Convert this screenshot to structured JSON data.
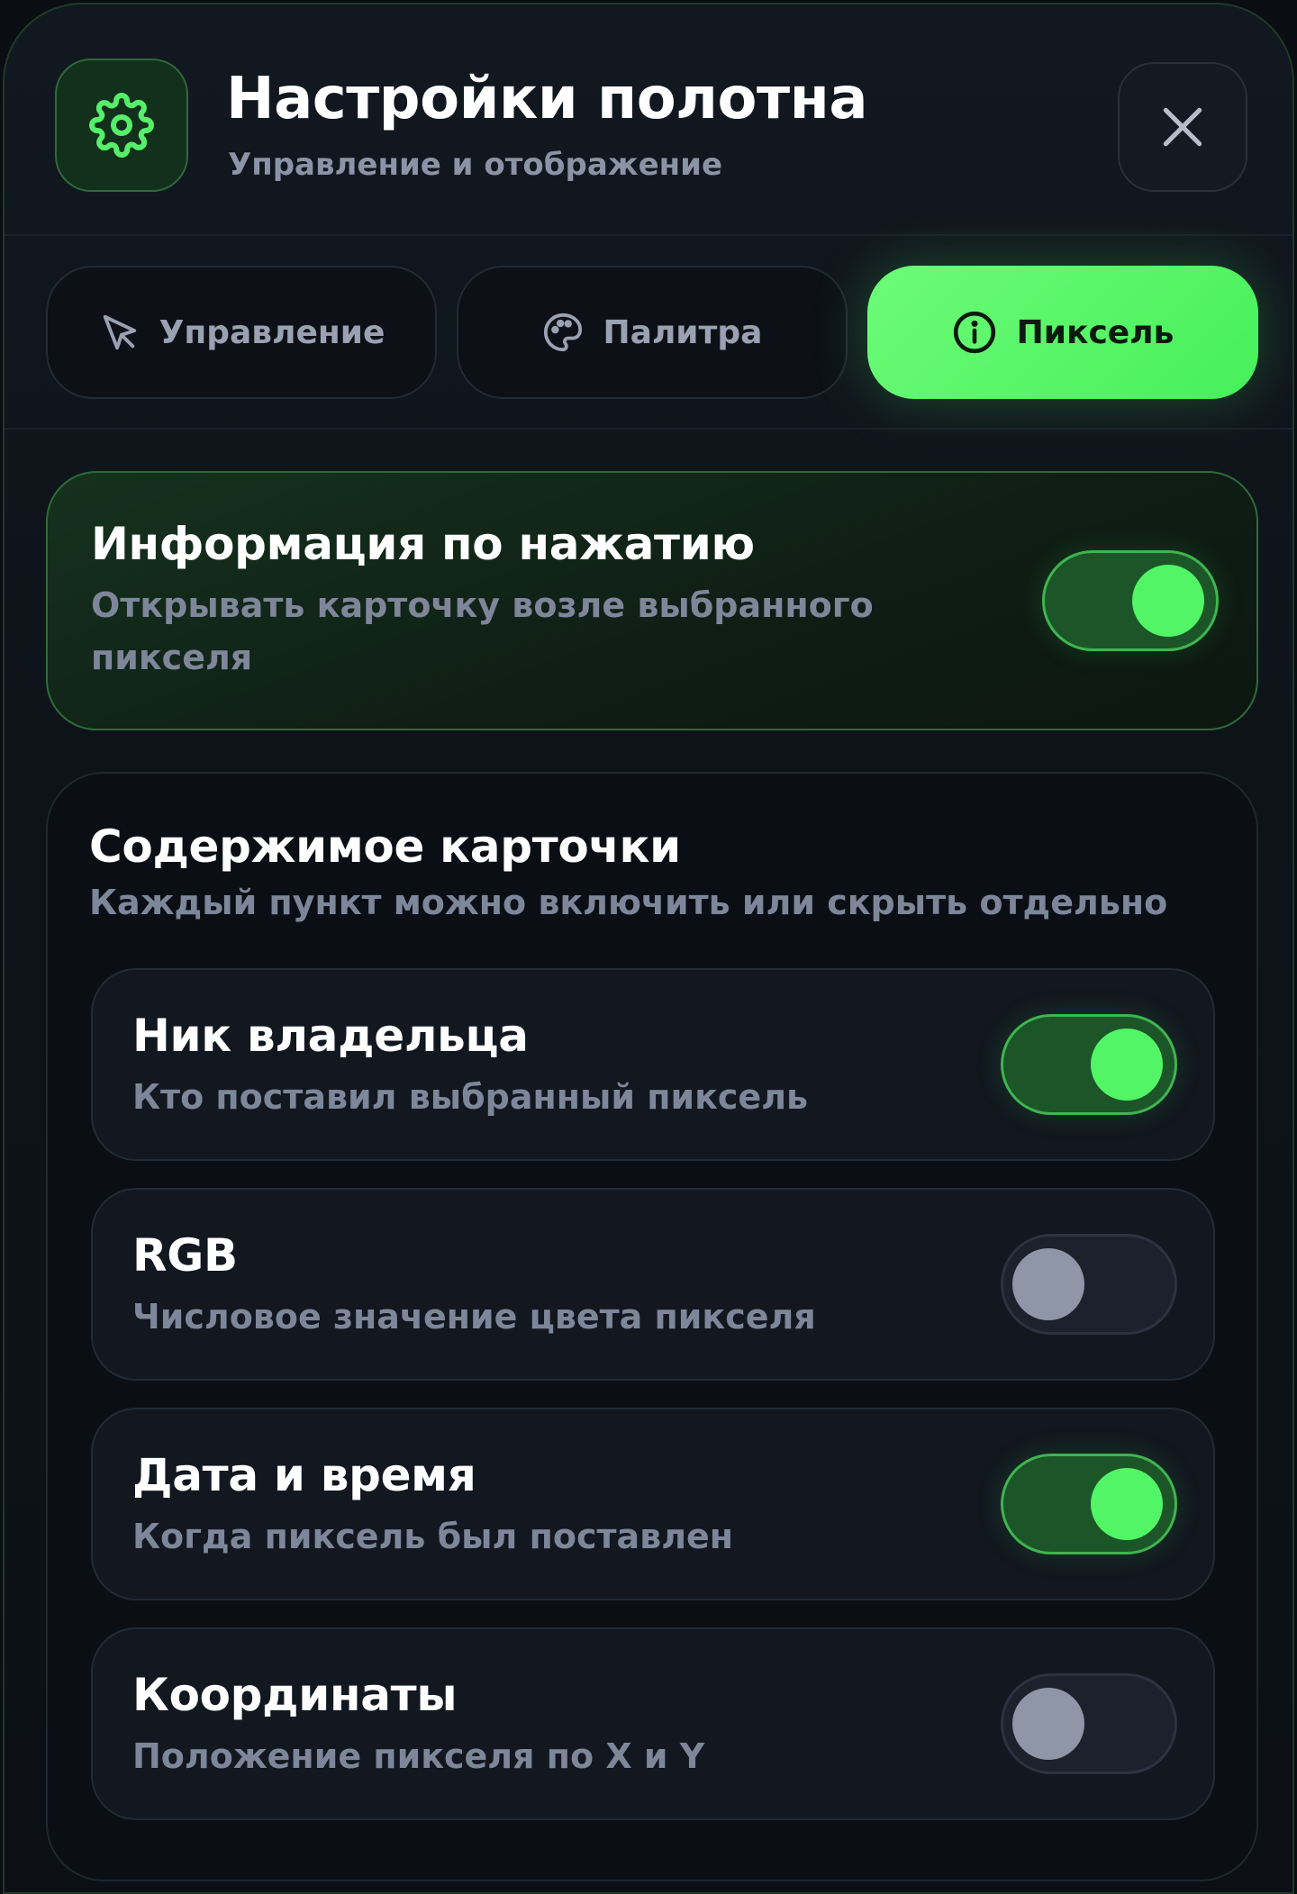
{
  "header": {
    "title": "Настройки полотна",
    "subtitle": "Управление и отображение",
    "icon": "gear-icon",
    "close_icon": "close-icon"
  },
  "tabs": [
    {
      "label": "Управление",
      "icon": "cursor-icon",
      "active": false
    },
    {
      "label": "Палитра",
      "icon": "palette-icon",
      "active": false
    },
    {
      "label": "Пиксель",
      "icon": "info-icon",
      "active": true
    }
  ],
  "info_on_click": {
    "title": "Информация по нажатию",
    "description_line1": "Открывать карточку возле выбранного",
    "description_line2": "пикселя",
    "enabled": true
  },
  "card_content": {
    "title": "Содержимое карточки",
    "description": "Каждый пункт можно включить или скрыть отдельно",
    "items": [
      {
        "title": "Ник владельца",
        "description": "Кто поставил выбранный пиксель",
        "enabled": true
      },
      {
        "title": "RGB",
        "description": "Числовое значение цвета пикселя",
        "enabled": false
      },
      {
        "title": "Дата и время",
        "description": "Когда пиксель был поставлен",
        "enabled": true
      },
      {
        "title": "Координаты",
        "description": "Положение пикселя по X и Y",
        "enabled": false
      }
    ]
  },
  "colors": {
    "accent": "#4df060",
    "background": "#0e131a",
    "muted_text": "#8b93a6"
  }
}
